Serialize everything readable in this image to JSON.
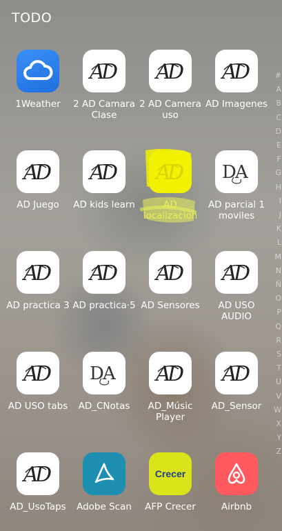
{
  "header": {
    "title": "TODO"
  },
  "apps": [
    {
      "label": "1Weather",
      "icon": "weather-cloud-icon"
    },
    {
      "label": "2 AD Camara Clase",
      "icon": "ad-logo-icon"
    },
    {
      "label": "2 AD Camera uso",
      "icon": "ad-logo-icon"
    },
    {
      "label": "AD Imagenes",
      "icon": "ad-logo-icon"
    },
    {
      "label": "AD Juego",
      "icon": "ad-logo-icon"
    },
    {
      "label": "AD kids learn",
      "icon": "ad-logo-icon"
    },
    {
      "label": "AD localizacion",
      "icon": "ad-logo-icon",
      "highlighted": true
    },
    {
      "label": "AD parcial 1 moviles",
      "icon": "dca-logo-icon"
    },
    {
      "label": "AD practica 3",
      "icon": "ad-logo-icon"
    },
    {
      "label": "AD practica·5",
      "icon": "ad-logo-icon"
    },
    {
      "label": "AD Sensores",
      "icon": "ad-logo-icon"
    },
    {
      "label": "AD USO AUDIO",
      "icon": "ad-logo-icon"
    },
    {
      "label": "AD USO tabs",
      "icon": "ad-logo-icon"
    },
    {
      "label": "AD_CNotas",
      "icon": "dca-logo-icon"
    },
    {
      "label": "AD_Músic Player",
      "icon": "ad-logo-icon"
    },
    {
      "label": "AD_Sensor",
      "icon": "ad-logo-icon"
    },
    {
      "label": "AD_UsoTaps",
      "icon": "ad-logo-icon"
    },
    {
      "label": "Adobe Scan",
      "icon": "adobe-scan-icon"
    },
    {
      "label": "AFP Crecer",
      "icon": "afp-crecer-icon",
      "icon_text": "Crecer"
    },
    {
      "label": "Airbnb",
      "icon": "airbnb-icon"
    }
  ],
  "alphabet_index": [
    "#",
    "A",
    "B",
    "C",
    "D",
    "E",
    "F",
    "G",
    "H",
    "I",
    "J",
    "K",
    "L",
    "M",
    "N",
    "Ñ",
    "O",
    "P",
    "Q",
    "R",
    "S",
    "T",
    "U",
    "V",
    "W",
    "X",
    "Y",
    "Z"
  ],
  "colors": {
    "highlight": "#f2f200",
    "weather_bg": "#2e7ff0",
    "adobe_bg": "#1d8fb0",
    "crecer_bg": "#dbe31a",
    "airbnb_bg": "#ff5a5f"
  }
}
